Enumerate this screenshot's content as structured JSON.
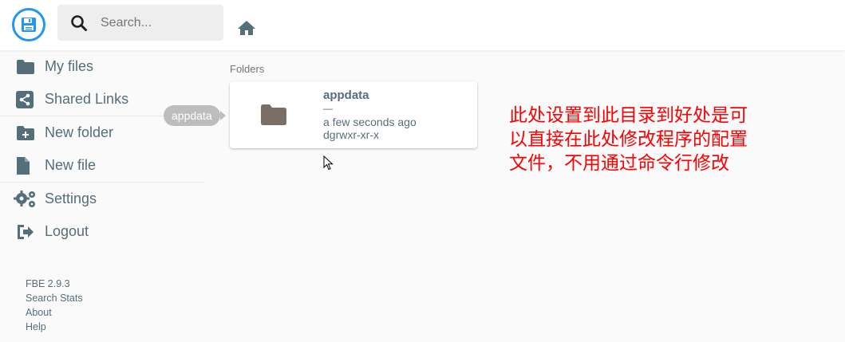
{
  "header": {
    "logo_icon": "floppy-disk-icon",
    "search_placeholder": "Search...",
    "home_icon": "home-icon"
  },
  "sidebar": {
    "items": [
      {
        "label": "My files",
        "icon": "folder-icon"
      },
      {
        "label": "Shared Links",
        "icon": "share-icon"
      },
      {
        "label": "New folder",
        "icon": "new-folder-icon"
      },
      {
        "label": "New file",
        "icon": "file-icon"
      },
      {
        "label": "Settings",
        "icon": "settings-icon"
      },
      {
        "label": "Logout",
        "icon": "logout-icon"
      }
    ],
    "footer": {
      "version": "FBE 2.9.3",
      "search_stats": "Search Stats",
      "about": "About",
      "help": "Help"
    }
  },
  "main": {
    "section_label": "Folders",
    "folders": [
      {
        "name": "appdata",
        "size": "—",
        "modified": "a few seconds ago",
        "permissions": "dgrwxr-xr-x"
      }
    ],
    "tooltip": "appdata"
  },
  "annotation": {
    "text": "此处设置到此目录到好处是可以直接在此处修改程序的配置文件，不用通过命令行修改"
  },
  "colors": {
    "accent": "#2196f3",
    "text": "#546e7a",
    "annotation": "#ff0000",
    "folder": "#7b6e66"
  }
}
